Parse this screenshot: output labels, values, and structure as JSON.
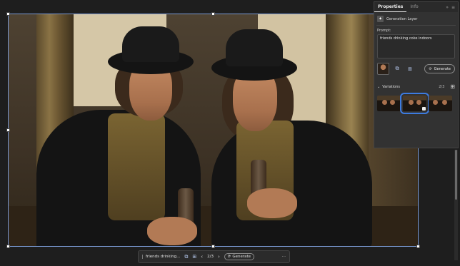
{
  "properties_panel": {
    "tabs": [
      {
        "label": "Properties",
        "active": true
      },
      {
        "label": "Info",
        "active": false
      }
    ],
    "collapse_icon": "double-chevron-right-icon",
    "menu_icon": "panel-menu-icon",
    "layer": {
      "icon": "generation-layer-icon",
      "label": "Generation Layer"
    },
    "prompt_label": "Prompt:",
    "prompt_value": "friends drinking coke indoors",
    "reference_icon": "reference-image-icon",
    "settings_icon": "generation-settings-icon",
    "generate_label": "Generate",
    "variations": {
      "label": "Variations",
      "counter": "2/3",
      "grid_icon": "grid-view-icon",
      "selected_index": 1,
      "count": 3
    }
  },
  "task_bar": {
    "prompt_text": "friends drinking...",
    "reference_icon": "reference-image-icon",
    "settings_icon": "generation-settings-icon",
    "prev_icon": "chevron-left-icon",
    "counter": "2/3",
    "next_icon": "chevron-right-icon",
    "generate_label": "Generate",
    "more_icon": "more-options-icon"
  },
  "colors": {
    "accent": "#3d7be0",
    "selection": "#7a9ad4",
    "panel_bg": "#323232",
    "canvas_bg": "#1e1e1e"
  }
}
